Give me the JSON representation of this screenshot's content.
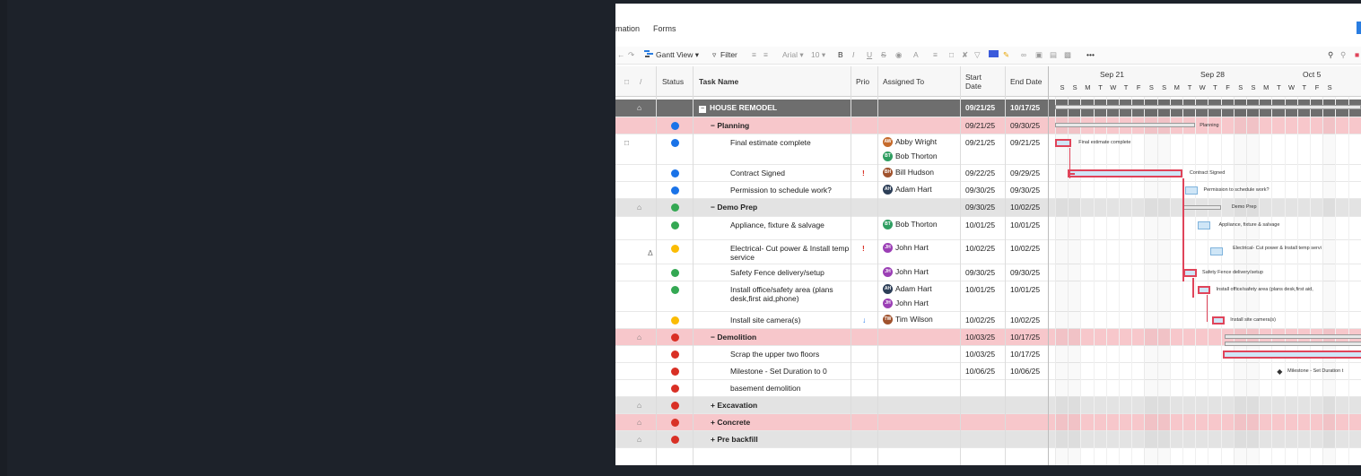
{
  "menu": {
    "items": [
      "mation",
      "Forms"
    ]
  },
  "toolbar": {
    "undo": "←",
    "redo": "↷",
    "gantt_view": "Gantt View ▾",
    "filter": "Filter",
    "font": "Arial ▾",
    "size": "10 ▾",
    "bold": "B",
    "italic": "I",
    "underline": "U",
    "strike": "S",
    "more": "•••"
  },
  "columns": {
    "status": "Status",
    "task": "Task Name",
    "prio": "Prio",
    "assigned": "Assigned To",
    "start": "Start Date",
    "end": "End Date"
  },
  "gantt": {
    "weeks": [
      "Sep 21",
      "Sep 28",
      "Oct 5"
    ],
    "days": [
      "S",
      "S",
      "M",
      "T",
      "W",
      "T",
      "F",
      "S",
      "S",
      "M",
      "T",
      "W",
      "T",
      "F",
      "S",
      "S",
      "M",
      "T",
      "W",
      "T",
      "F",
      "S"
    ]
  },
  "rows": [
    {
      "type": "top",
      "lock": "⌂",
      "task": "HOUSE REMODEL",
      "start": "09/21/25",
      "end": "10/17/25"
    },
    {
      "type": "section",
      "tone": "pink",
      "status": "#1a73e8",
      "task": "Planning",
      "start": "09/21/25",
      "end": "09/30/25"
    },
    {
      "type": "task",
      "status": "#1a73e8",
      "task": "Final estimate complete",
      "assignees": [
        {
          "initials": "AW",
          "name": "Abby Wright",
          "color": "#c56a2b"
        },
        {
          "initials": "BT",
          "name": "Bob Thorton",
          "color": "#2f9e61"
        }
      ],
      "start": "09/21/25",
      "end": "09/21/25",
      "comment": "□"
    },
    {
      "type": "task",
      "status": "#1a73e8",
      "task": "Contract Signed",
      "prio": "!",
      "assignees": [
        {
          "initials": "BH",
          "name": "Bill Hudson",
          "color": "#a0522d"
        }
      ],
      "start": "09/22/25",
      "end": "09/29/25"
    },
    {
      "type": "task",
      "status": "#1a73e8",
      "task": "Permission to schedule work?",
      "assignees": [
        {
          "initials": "AH",
          "name": "Adam Hart",
          "color": "#2c3e57"
        }
      ],
      "start": "09/30/25",
      "end": "09/30/25"
    },
    {
      "type": "section",
      "tone": "gray",
      "status": "#34a853",
      "task": "Demo Prep",
      "start": "09/30/25",
      "end": "10/02/25",
      "lock": "⌂"
    },
    {
      "type": "task",
      "status": "#34a853",
      "task": "Appliance, fixture & salvage",
      "assignees": [
        {
          "initials": "BT",
          "name": "Bob Thorton",
          "color": "#2f9e61"
        }
      ],
      "start": "10/01/25",
      "end": "10/01/25"
    },
    {
      "type": "task",
      "status": "#fbbc04",
      "task": "Electrical- Cut power & Install temp service",
      "prio": "!",
      "assignees": [
        {
          "initials": "JH",
          "name": "John Hart",
          "color": "#9b3fb5"
        }
      ],
      "start": "10/02/25",
      "end": "10/02/25",
      "bell": "Δ"
    },
    {
      "type": "task",
      "status": "#34a853",
      "task": "Safety Fence delivery/setup",
      "assignees": [
        {
          "initials": "JH",
          "name": "John Hart",
          "color": "#9b3fb5"
        }
      ],
      "start": "09/30/25",
      "end": "09/30/25"
    },
    {
      "type": "task",
      "status": "#34a853",
      "task": "Install office/safety area (plans desk,first aid,phone)",
      "assignees": [
        {
          "initials": "AH",
          "name": "Adam Hart",
          "color": "#2c3e57"
        },
        {
          "initials": "JH",
          "name": "John Hart",
          "color": "#9b3fb5"
        }
      ],
      "start": "10/01/25",
      "end": "10/01/25"
    },
    {
      "type": "task",
      "status": "#fbbc04",
      "task": "Install site camera(s)",
      "prio": "↓",
      "assignees": [
        {
          "initials": "TW",
          "name": "Tim Wilson",
          "color": "#a0522d"
        }
      ],
      "start": "10/02/25",
      "end": "10/02/25"
    },
    {
      "type": "section",
      "tone": "pink",
      "status": "#d93025",
      "task": "Demolition",
      "start": "10/03/25",
      "end": "10/17/25",
      "lock": "⌂"
    },
    {
      "type": "task",
      "status": "#d93025",
      "task": "Scrap the upper two floors",
      "start": "10/03/25",
      "end": "10/17/25"
    },
    {
      "type": "task",
      "status": "#d93025",
      "task": "Milestone - Set Duration to 0",
      "start": "10/06/25",
      "end": "10/06/25"
    },
    {
      "type": "task",
      "status": "#d93025",
      "task": "basement demolition"
    },
    {
      "type": "section",
      "tone": "gray",
      "status": "#d93025",
      "task": "Excavation",
      "collapsed": true,
      "lock": "⌂"
    },
    {
      "type": "section",
      "tone": "pink",
      "status": "#d93025",
      "task": "Concrete",
      "collapsed": true,
      "lock": "⌂"
    },
    {
      "type": "section",
      "tone": "gray",
      "status": "#d93025",
      "task": "Pre backfill",
      "collapsed": true,
      "lock": "⌂"
    }
  ],
  "gantt_labels": {
    "planning": "Planning",
    "final": "Final estimate complete",
    "contract": "Contract Signed",
    "permission": "Permission to schedule work?",
    "demoprep": "Demo Prep",
    "appliance": "Appliance, fixture & salvage",
    "electrical": "Electrical- Cut power & Install temp servi",
    "fence": "Safety Fence delivery/setup",
    "office": "Install office/safety area (plans desk,first aid,",
    "camera": "Install site camera(s)",
    "milestone": "Milestone - Set Duration t"
  }
}
